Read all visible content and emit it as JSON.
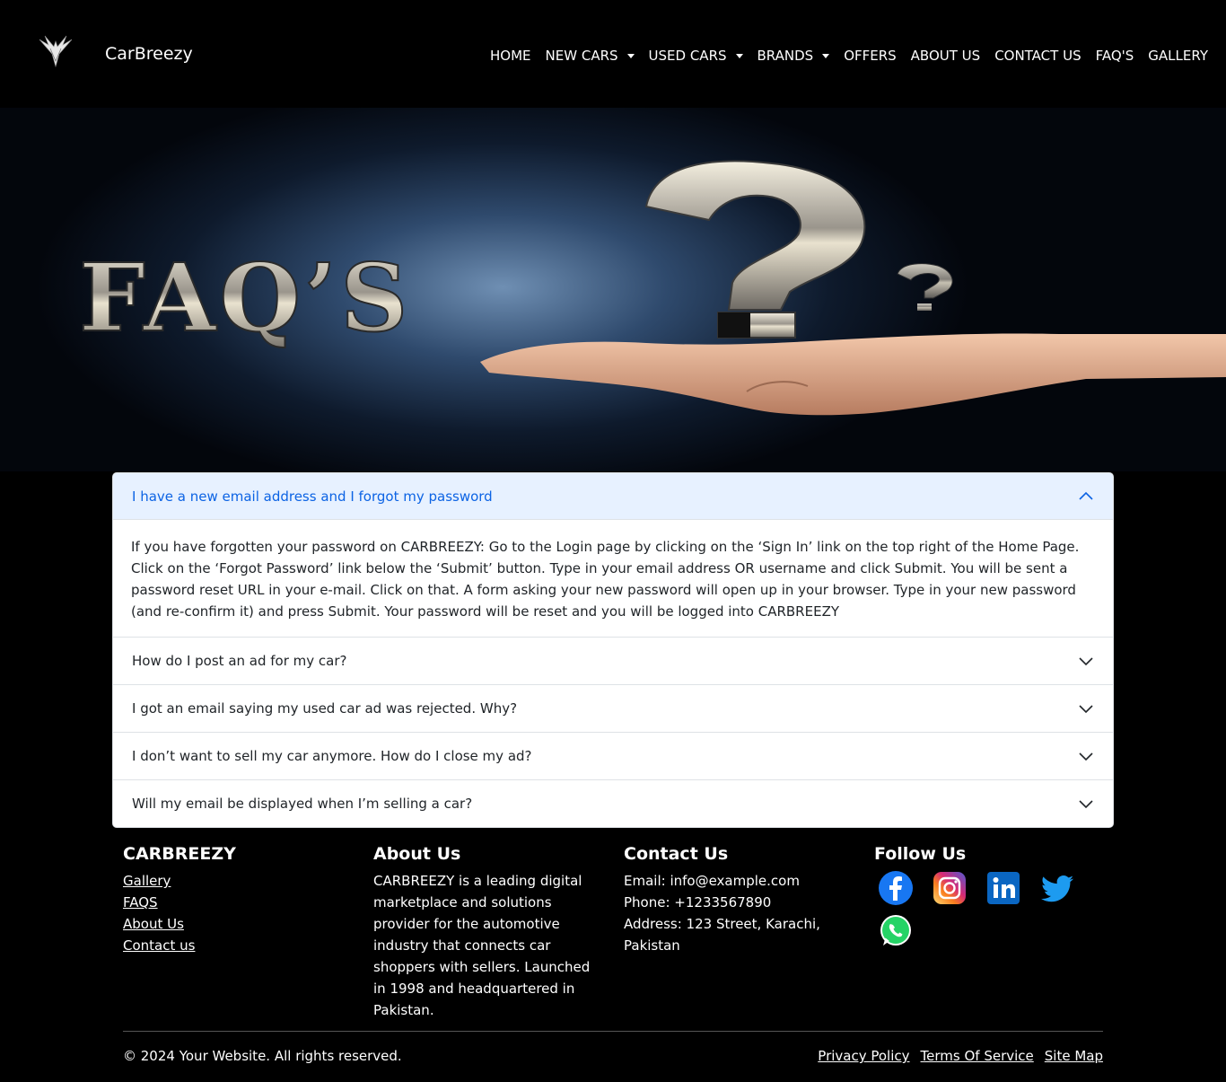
{
  "brand": "CarBreezy",
  "nav": {
    "home": "HOME",
    "new_cars": "NEW CARS",
    "used_cars": "USED CARS",
    "brands": "BRANDS",
    "offers": "OFFERS",
    "about": "ABOUT US",
    "contact": "CONTACT US",
    "faqs": "FAQ'S",
    "gallery": "GALLERY"
  },
  "hero": {
    "title": "FAQ’S"
  },
  "faq": [
    {
      "question": "I have a new email address and I forgot my password",
      "answer": "If you have forgotten your password on CARBREEZY: Go to the Login page by clicking on the ‘Sign In’ link on the top right of the Home Page. Click on the ‘Forgot Password’ link below the ‘Submit’ button. Type in your email address OR username and click Submit. You will be sent a password reset URL in your e-mail. Click on that. A form asking your new password will open up in your browser. Type in your new password (and re-confirm it) and press Submit. Your password will be reset and you will be logged into CARBREEZY",
      "expanded": true
    },
    {
      "question": "How do I post an ad for my car?",
      "expanded": false
    },
    {
      "question": "I got an email saying my used car ad was rejected. Why?",
      "expanded": false
    },
    {
      "question": "I don’t want to sell my car anymore. How do I close my ad?",
      "expanded": false
    },
    {
      "question": "Will my email be displayed when I’m selling a car?",
      "expanded": false
    }
  ],
  "footer": {
    "col1": {
      "title": "CARBREEZY",
      "links": [
        "Gallery",
        "FAQS",
        "About Us",
        "Contact us"
      ]
    },
    "about": {
      "title": "About Us",
      "text": "CARBREEZY is a leading digital marketplace and solutions provider for the automotive industry that connects car shoppers with sellers. Launched in 1998 and headquartered in Pakistan."
    },
    "contact": {
      "title": "Contact Us",
      "email": "Email: info@example.com",
      "phone": "Phone: +1233567890",
      "address": "Address: 123 Street, Karachi, Pakistan"
    },
    "follow": {
      "title": "Follow Us",
      "icons": [
        "facebook-icon",
        "instagram-icon",
        "linkedin-icon",
        "twitter-icon",
        "whatsapp-icon"
      ]
    },
    "copyright": "© 2024 Your Website. All rights reserved.",
    "legal": [
      "Privacy Policy",
      "Terms Of Service",
      "Site Map"
    ]
  },
  "colors": {
    "accordion_active_bg": "#e7f1ff",
    "accordion_active_text": "#0c63e4",
    "page_bg": "#000000"
  }
}
